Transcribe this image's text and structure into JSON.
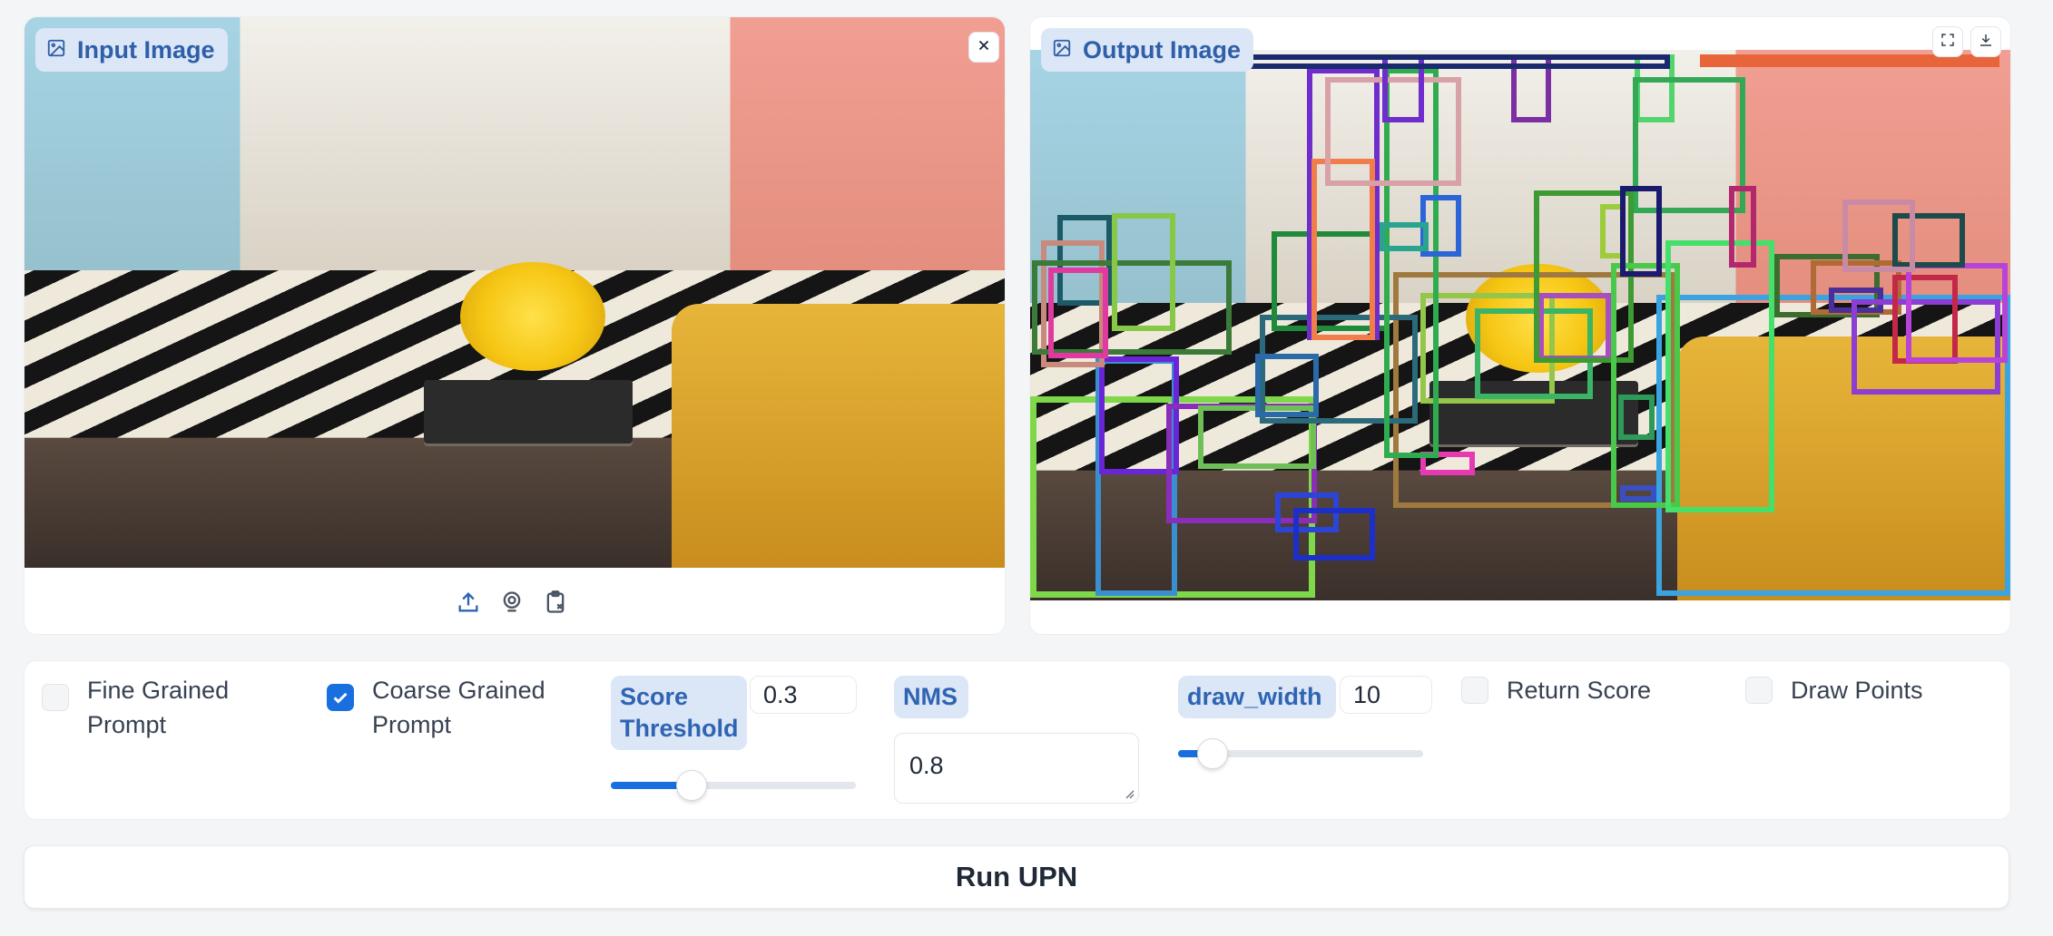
{
  "input_panel": {
    "label": "Input Image",
    "icon": "image-icon",
    "clear_icon": "close-icon",
    "source_icons": [
      "upload-icon",
      "webcam-icon",
      "clipboard-icon"
    ]
  },
  "output_panel": {
    "label": "Output Image",
    "icon": "image-icon",
    "action_icons": [
      "fullscreen-icon",
      "download-icon"
    ]
  },
  "controls": {
    "fine_grained": {
      "label": "Fine Grained Prompt",
      "checked": false
    },
    "coarse_grained": {
      "label": "Coarse Grained Prompt",
      "checked": true
    },
    "score_threshold": {
      "label": "Score Threshold",
      "value": "0.3",
      "fraction": 0.33
    },
    "nms": {
      "label": "NMS",
      "value": "0.8"
    },
    "draw_width": {
      "label": "draw_width",
      "value": "10",
      "fraction": 0.14
    },
    "return_score": {
      "label": "Return Score",
      "checked": false
    },
    "draw_points": {
      "label": "Draw Points",
      "checked": false
    }
  },
  "run_button": {
    "label": "Run UPN"
  },
  "colors": {
    "accent": "#1a6fe0",
    "label_bg": "#dbe6f6",
    "label_text": "#2f5fa8"
  }
}
